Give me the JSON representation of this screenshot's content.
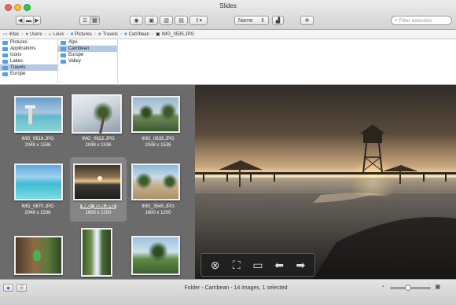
{
  "window": {
    "title": "Slides"
  },
  "toolbar": {
    "sort": {
      "selected": "Name"
    }
  },
  "search": {
    "placeholder": "Filter selection"
  },
  "breadcrumb": [
    {
      "label": "iMac",
      "icon": "computer-icon"
    },
    {
      "label": "Users",
      "icon": "folder-icon"
    },
    {
      "label": "Louis",
      "icon": "home-icon"
    },
    {
      "label": "Pictures",
      "icon": "folder-icon"
    },
    {
      "label": "Travels",
      "icon": "folder-icon"
    },
    {
      "label": "Carribean",
      "icon": "folder-icon"
    },
    {
      "label": "IMG_3535.JPG",
      "icon": "image-icon"
    }
  ],
  "browser": {
    "column1": [
      "Pictures",
      "Applications",
      "Icons",
      "Lakes",
      "Travels",
      "Europe"
    ],
    "column2": [
      "Alps",
      "Carribean",
      "Europe",
      "Valley"
    ]
  },
  "thumbnails": [
    {
      "name": "IMG_0618.JPG",
      "size": "2048 x 1536"
    },
    {
      "name": "IMG_0622.JPG",
      "size": "2048 x 1536"
    },
    {
      "name": "IMG_0635.JPG",
      "size": "2048 x 1536"
    },
    {
      "name": "IMG_0670.JPG",
      "size": "2048 x 1536"
    },
    {
      "name": "IMG_3535.JPG",
      "size": "1600 x 1200"
    },
    {
      "name": "IMG_3545.JPG",
      "size": "1600 x 1200"
    },
    {
      "name": "",
      "size": ""
    },
    {
      "name": "",
      "size": ""
    },
    {
      "name": "",
      "size": ""
    }
  ],
  "status": {
    "text": "Folder - Carribean - 14 images, 1 selected",
    "zoom_fraction": 0.45
  },
  "colors": {
    "accent": "#3d7fd6",
    "grid_bg": "#6b6b6b",
    "sky_top": "#33302c",
    "sun": "#fff6d8"
  }
}
